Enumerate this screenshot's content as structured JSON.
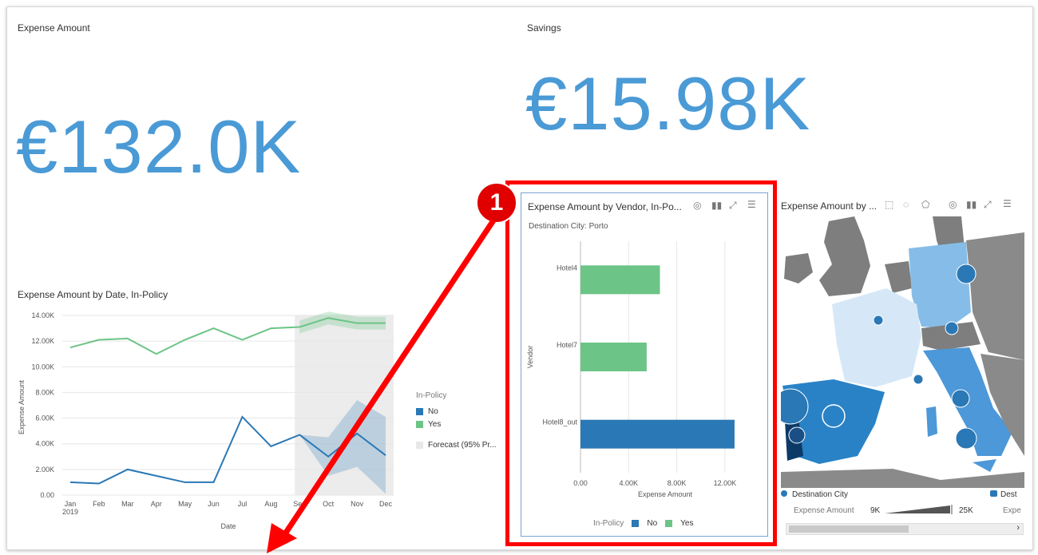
{
  "tiles": {
    "expense": {
      "title": "Expense Amount",
      "value": "€132.0K"
    },
    "savings": {
      "title": "Savings",
      "value": "€15.98K"
    }
  },
  "line_chart": {
    "title": "Expense Amount by Date, In-Policy",
    "ylabel": "Expense Amount",
    "xlabel": "Date",
    "legend_title": "In-Policy",
    "legend": [
      "No",
      "Yes"
    ],
    "forecast_label": "Forecast (95% Pr...",
    "yticks": [
      "0.00",
      "2.00K",
      "4.00K",
      "6.00K",
      "8.00K",
      "10.00K",
      "12.00K",
      "14.00K"
    ],
    "xticks": [
      "Jan",
      "Feb",
      "Mar",
      "Apr",
      "May",
      "Jun",
      "Jul",
      "Aug",
      "Sep",
      "Oct",
      "Nov",
      "Dec"
    ],
    "year_label": "2019"
  },
  "vendor_card": {
    "title": "Expense Amount by Vendor, In-Po...",
    "filter": "Destination City: Porto",
    "ylabel": "Vendor",
    "xlabel": "Expense Amount",
    "legend_title": "In-Policy",
    "legend": [
      "No",
      "Yes"
    ],
    "xticks": [
      "0.00",
      "4.00K",
      "8.00K",
      "12.00K"
    ]
  },
  "map_card": {
    "title": "Expense Amount by ...",
    "legend_city": "Destination City",
    "legend_dest": "Dest",
    "legend_amount": "Expense Amount",
    "range_min": "9K",
    "range_max": "25K",
    "legend_amount_short": "Expe"
  },
  "annotation": {
    "badge": "1"
  },
  "colors": {
    "accent": "#4a9ad6",
    "no": "#2a78b5",
    "yes": "#6cc487",
    "annotation": "#ff0000"
  },
  "chart_data": [
    {
      "type": "line",
      "title": "Expense Amount by Date, In-Policy",
      "xlabel": "Date",
      "ylabel": "Expense Amount",
      "categories": [
        "Jan",
        "Feb",
        "Mar",
        "Apr",
        "May",
        "Jun",
        "Jul",
        "Aug",
        "Sep",
        "Oct",
        "Nov",
        "Dec"
      ],
      "ylim": [
        0,
        14000
      ],
      "series": [
        {
          "name": "Yes",
          "values": [
            11500,
            12100,
            12200,
            11000,
            12100,
            13000,
            12100,
            13000,
            13100,
            13800,
            13400,
            13400
          ]
        },
        {
          "name": "No",
          "values": [
            1000,
            900,
            2000,
            1500,
            1000,
            1000,
            6100,
            3800,
            4700,
            3000,
            4800,
            3100
          ]
        }
      ],
      "forecast_from": "Sep",
      "grid": true,
      "legend_position": "right"
    },
    {
      "type": "bar",
      "orientation": "horizontal",
      "title": "Expense Amount by Vendor, In-Po...",
      "xlabel": "Expense Amount",
      "ylabel": "Vendor",
      "categories": [
        "Hotel4",
        "Hotel7",
        "Hotel8_out"
      ],
      "series": [
        {
          "name": "Yes",
          "values": [
            6600,
            5500,
            null
          ]
        },
        {
          "name": "No",
          "values": [
            null,
            null,
            12800
          ]
        }
      ],
      "xlim": [
        0,
        14000
      ],
      "grid": true,
      "legend_position": "bottom"
    }
  ]
}
